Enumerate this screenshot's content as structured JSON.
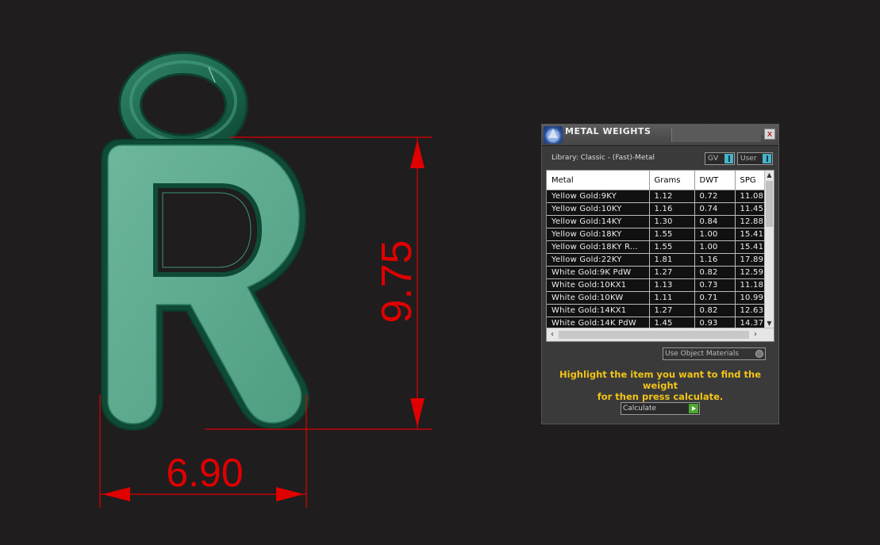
{
  "viewport": {
    "dimension_height": "9.75",
    "dimension_width": "6.90",
    "dimension_color": "#e00000",
    "model_color": "#5aa68a"
  },
  "panel": {
    "title": "METAL WEIGHTS",
    "close_label": "x",
    "library_label": "Library: Classic - (Fast)-Metal",
    "gv_label": "GV",
    "user_label": "User",
    "columns": [
      "Metal",
      "Grams",
      "DWT",
      "SPG"
    ],
    "rows": [
      [
        "Yellow Gold:9KY",
        "1.12",
        "0.72",
        "11.08"
      ],
      [
        "Yellow Gold:10KY",
        "1.16",
        "0.74",
        "11.45"
      ],
      [
        "Yellow Gold:14KY",
        "1.30",
        "0.84",
        "12.88"
      ],
      [
        "Yellow Gold:18KY",
        "1.55",
        "1.00",
        "15.41"
      ],
      [
        "Yellow Gold:18KY R...",
        "1.55",
        "1.00",
        "15.41"
      ],
      [
        "Yellow Gold:22KY",
        "1.81",
        "1.16",
        "17.89"
      ],
      [
        "White Gold:9K PdW",
        "1.27",
        "0.82",
        "12.59"
      ],
      [
        "White Gold:10KX1",
        "1.13",
        "0.73",
        "11.18"
      ],
      [
        "White Gold:10KW",
        "1.11",
        "0.71",
        "10.99"
      ],
      [
        "White Gold:14KX1",
        "1.27",
        "0.82",
        "12.63"
      ],
      [
        "White Gold:14K PdW",
        "1.45",
        "0.93",
        "14.37"
      ]
    ],
    "use_object_materials": "Use Object Materials",
    "hint_line1": "Highlight the item you want to find the weight",
    "hint_line2": "for then press calculate.",
    "calculate_label": "Calculate",
    "accent_color": "#f2c417"
  }
}
